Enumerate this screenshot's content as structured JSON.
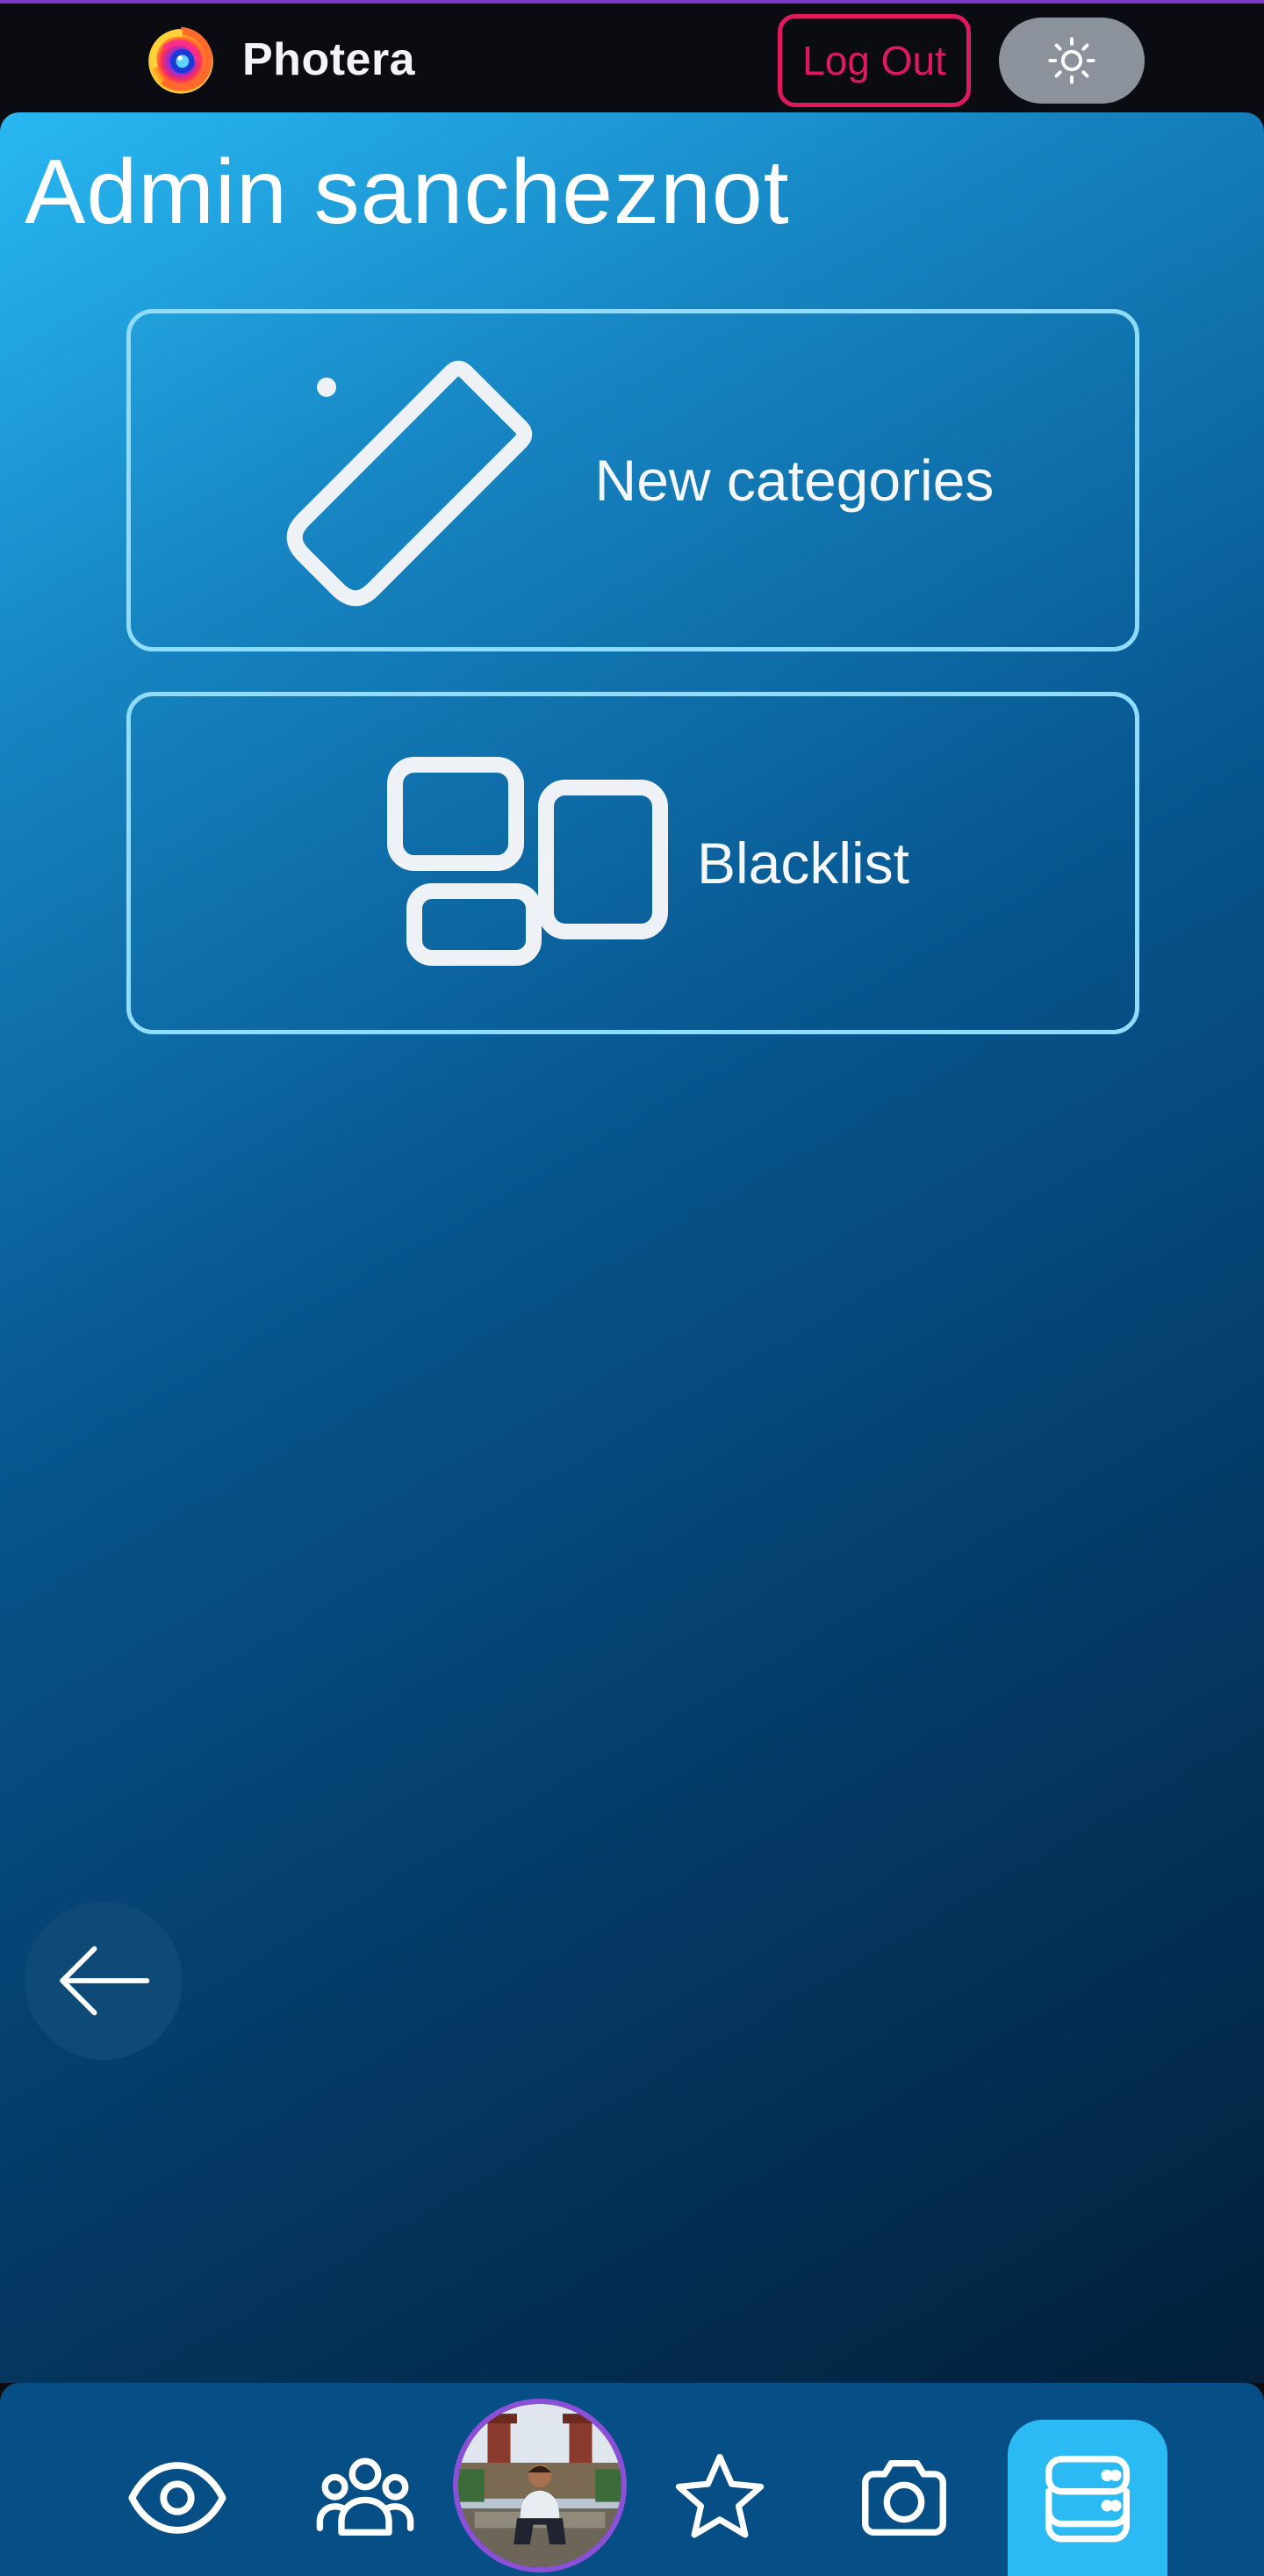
{
  "app": {
    "name": "Photera"
  },
  "header": {
    "logout_label": "Log Out",
    "theme_icon": "sun-icon"
  },
  "main": {
    "title": "Admin sancheznot",
    "cards": [
      {
        "label": "New categories",
        "icon": "tag-icon"
      },
      {
        "label": "Blacklist",
        "icon": "layout-blocks-icon"
      }
    ],
    "back_icon": "arrow-left-icon"
  },
  "bottom_nav": {
    "items": [
      {
        "icon": "eye-icon",
        "active": false
      },
      {
        "icon": "people-icon",
        "active": false
      },
      {
        "icon": "avatar",
        "active": false
      },
      {
        "icon": "star-icon",
        "active": false
      },
      {
        "icon": "camera-icon",
        "active": false
      },
      {
        "icon": "database-icon",
        "active": true
      }
    ]
  },
  "colors": {
    "accent_logout": "#e0195f",
    "active_nav": "#2cbaf5",
    "card_border": "#8fdcff",
    "avatar_ring": "#8b4fd8"
  }
}
